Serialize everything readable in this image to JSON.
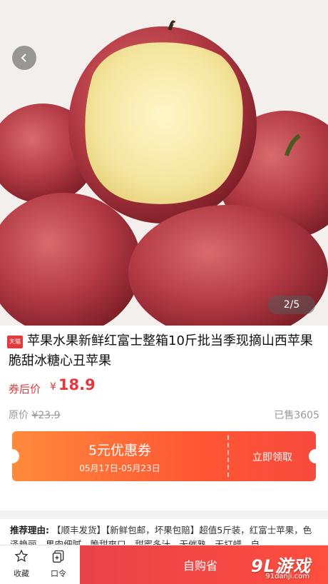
{
  "gallery": {
    "counter": "2/5"
  },
  "product": {
    "badge": "天猫",
    "title": "苹果水果新鲜红富士整箱10斤批当季现摘山西苹果脆甜冰糖心丑苹果",
    "price_label": "券后价",
    "currency": "¥",
    "price": "18.9",
    "original_label": "原价",
    "original_price": "¥23.9",
    "sold": "已售3605"
  },
  "coupon": {
    "title": "5元优惠券",
    "dates": "05月17日-05月23日",
    "claim": "立即领取"
  },
  "reason": {
    "label": "推荐理由:",
    "text": "【顺丰发货】【新鲜包邮，坏果包赔】超值5斤装，红富士苹果，色泽艳丽，果肉细腻，脆甜爽口，甜蜜多汁，无催熟，无打蜡，自"
  },
  "bottom": {
    "favorite": "收藏",
    "password": "口令",
    "buy": "自购省"
  },
  "watermark": {
    "logo": "9L游戏",
    "url": "91danji.com"
  },
  "colors": {
    "accent": "#e4393c",
    "coupon_start": "#ff8a3c",
    "coupon_end": "#f84a3d"
  }
}
